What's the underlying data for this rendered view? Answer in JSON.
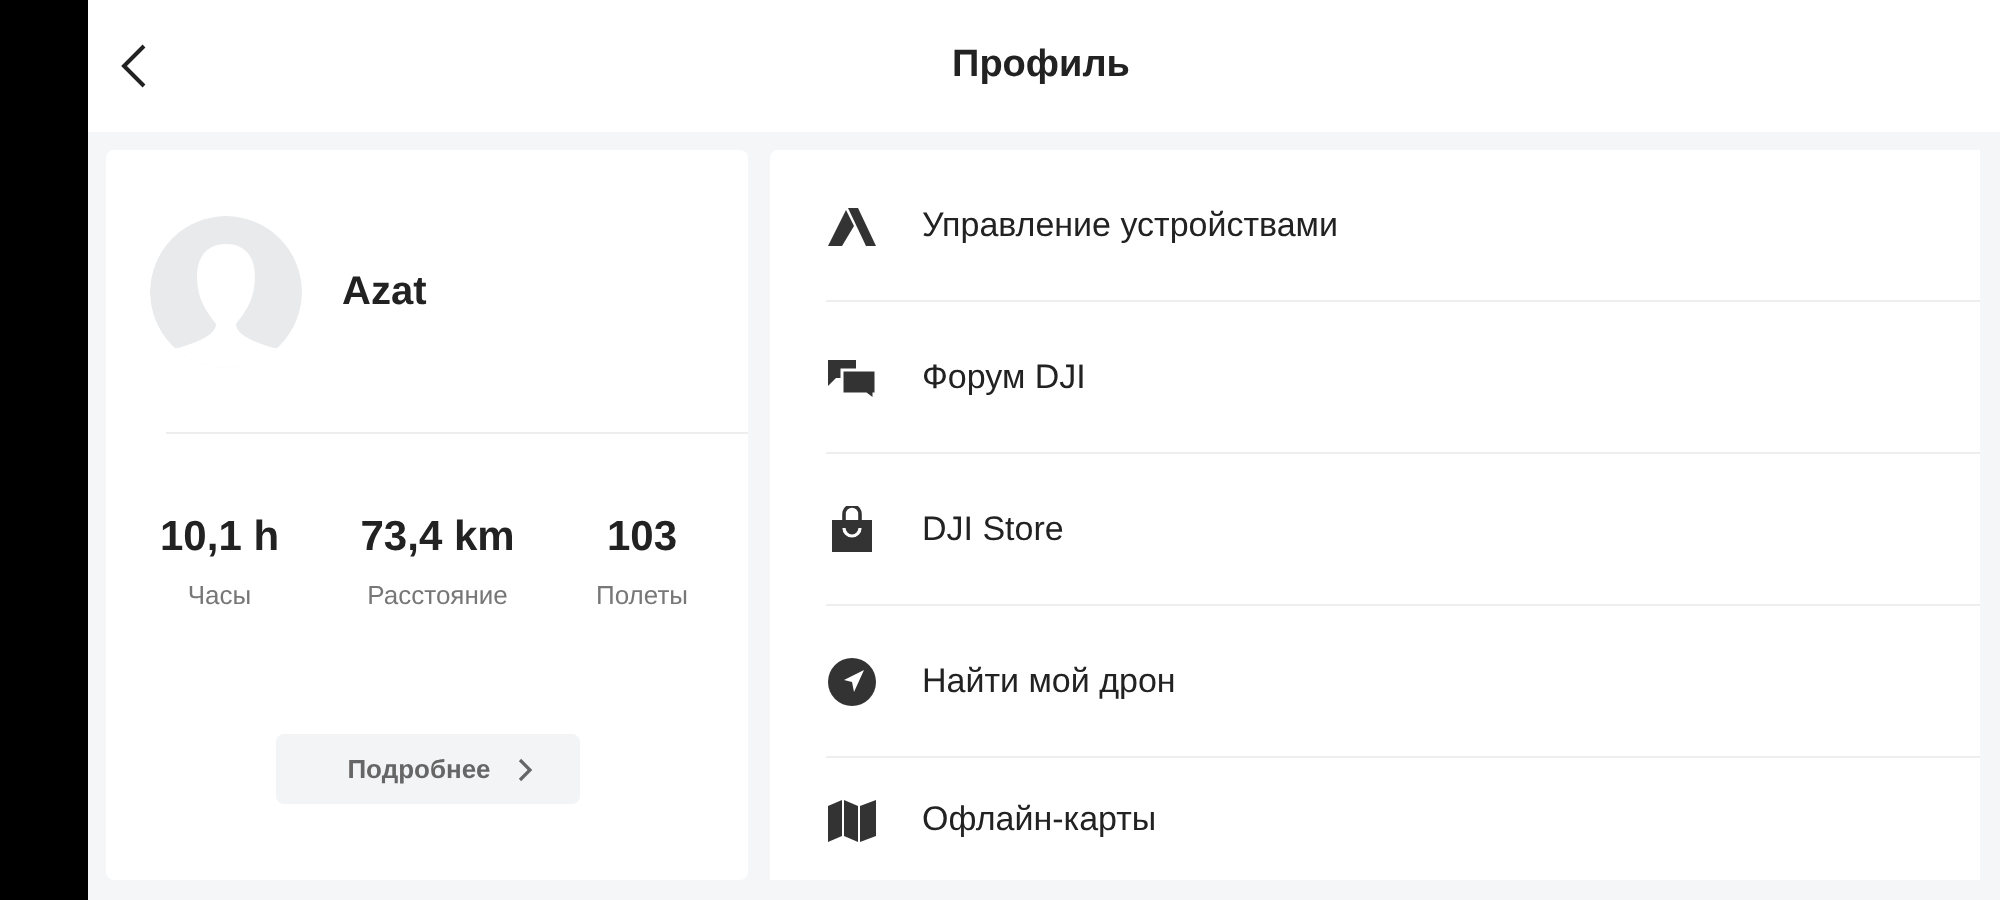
{
  "header": {
    "title": "Профиль"
  },
  "profile": {
    "name": "Azat",
    "stats": [
      {
        "value": "10,1 h",
        "label": "Часы"
      },
      {
        "value": "73,4 km",
        "label": "Расстояние"
      },
      {
        "value": "103",
        "label": "Полеты"
      }
    ],
    "details_button": "Подробнее"
  },
  "menu": [
    {
      "kind": "devices",
      "label": "Управление устройствами"
    },
    {
      "kind": "forum",
      "label": "Форум DJI"
    },
    {
      "kind": "store",
      "label": "DJI Store"
    },
    {
      "kind": "find",
      "label": "Найти мой дрон"
    },
    {
      "kind": "maps",
      "label": "Офлайн-карты"
    }
  ]
}
